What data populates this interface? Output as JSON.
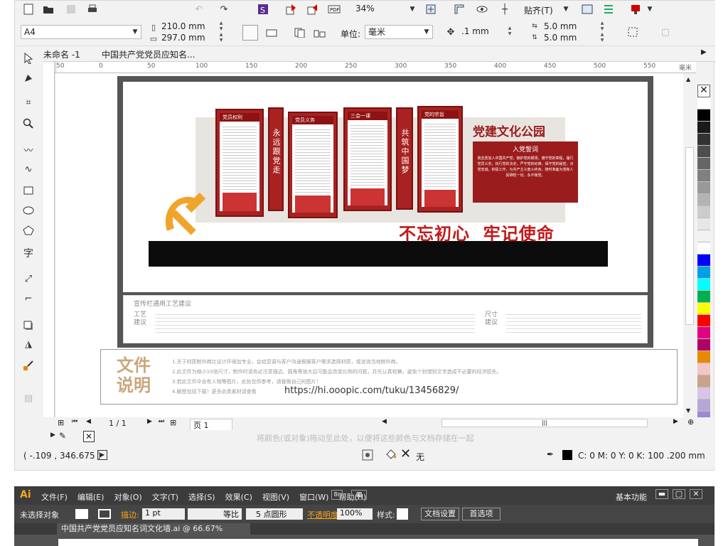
{
  "toolbar_top": {
    "zoom": "34%",
    "snap_label": "贴齐(T)"
  },
  "toolbar_prop": {
    "page_size": "A4",
    "width": "210.0 mm",
    "height": "297.0 mm",
    "units_label": "单位:",
    "units_value": "毫米",
    "nudge": ".1 mm",
    "dup_x": "5.0 mm",
    "dup_y": "5.0 mm"
  },
  "tabs": [
    "未命名 -1",
    "中国共产党党员应知名..."
  ],
  "ruler_ticks": [
    "50",
    "0",
    "50",
    "100",
    "150",
    "200",
    "250",
    "300",
    "350",
    "400",
    "450",
    "500",
    "550",
    "毫米"
  ],
  "artwork": {
    "panel_titles": [
      "党员权利",
      "党员义务",
      "三会一课",
      "党的宗旨"
    ],
    "vertical_slogans": [
      "永远跟党走",
      "共筑中国梦"
    ],
    "headline": "党建文化公园",
    "oath_title": "入党誓词",
    "oath_text": "我志愿加入中国共产党，拥护党的纲领，遵守党的章程，履行党员义务，执行党的决定，严守党的纪律，保守党的秘密，对党忠诚，积极工作，为共产主义奋斗终身，随时准备为党和人民牺牲一切，永不叛党。",
    "slogan": "不忘初心  牢记使命",
    "craft_title": "宣传栏通用工艺建议",
    "craft_left": "工艺建议",
    "craft_right": "尺寸建议",
    "note_title": "文件说明",
    "note_lines": [
      "1.关于材质制作商比设计环境加专业，会给您调与客户沟通根据客户需求选择材质，或咨询当地制作商。",
      "2.此文件为缩小10倍尺寸，制作时请务必注意描边、圆角等放大后可能会改变比例的问题，并先认真校稿，避免个别错别文字造成不必要的经济损失。",
      "3.若此文件中含有人物等图片，此处仅供参考，请替换自己的图片！",
      "4.解图包括下载！更多此类素材请查看"
    ],
    "note_url": "https://hi.ooopic.com/tuku/13456829/"
  },
  "page_nav": {
    "current": "1 / 1",
    "page_tab": "页 1"
  },
  "status_hint": "将颜色(或对象)拖动至此处，以便将这些颜色与文档存储在一起",
  "status": {
    "coords": "( -.109 , 346.675 )",
    "fill_label": "无",
    "outline": "C: 0 M: 0 Y: 0 K: 100  .200 mm"
  },
  "palette": [
    "#ffffff",
    "#000000",
    "#1a1a1a",
    "#333333",
    "#4d4d4d",
    "#666666",
    "#808080",
    "#999999",
    "#b3b3b3",
    "#cccccc",
    "#e6e6e6",
    "#f2f2f2",
    "#ffffff",
    "#0000ff",
    "#00a0e9",
    "#00ffff",
    "#00b050",
    "#ffff00",
    "#ff0000",
    "#e4007f",
    "#b0006a",
    "#e78a00",
    "#f6c5c5",
    "#c9a38a",
    "#d9c3e6",
    "#b7a7d8",
    "#9a8bd1",
    "#7a5fc4"
  ],
  "illustrator": {
    "logo": "Ai",
    "menu": [
      "文件(F)",
      "编辑(E)",
      "对象(O)",
      "文字(T)",
      "选择(S)",
      "效果(C)",
      "视图(V)",
      "窗口(W)",
      "帮助(H)"
    ],
    "workspace": "基本功能",
    "no_selection": "未选择对象",
    "stroke_label": "描边:",
    "stroke_value": "1 pt",
    "uniform": "等比",
    "brush": "5 点圆形",
    "opacity_label": "不透明度:",
    "opacity_value": "100%",
    "style_label": "样式:",
    "doc_setup": "文档设置",
    "prefs": "首选项",
    "doc_tab": "中国共产党党员应知名词文化墙.ai @ 66.67% (CMYK/预览)"
  }
}
